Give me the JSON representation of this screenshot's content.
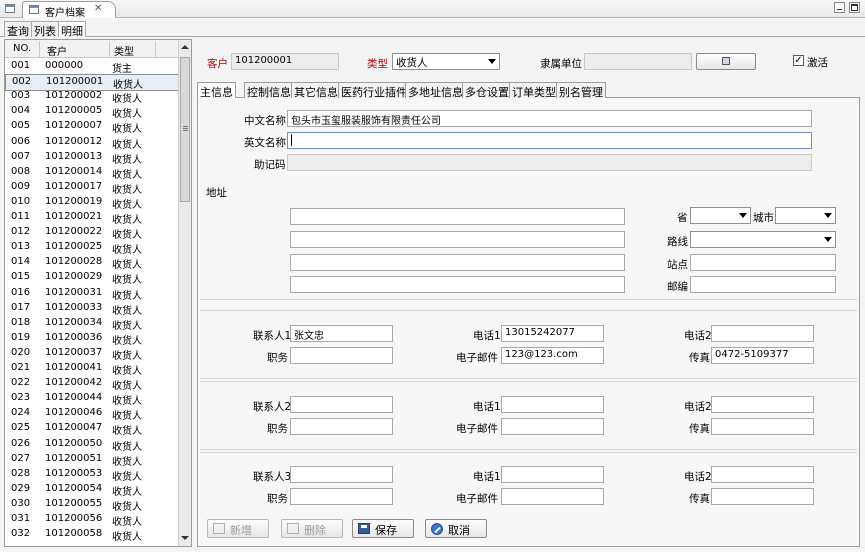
{
  "window": {
    "tab_title": "客户档案",
    "close_glyph": "✕"
  },
  "subtabs": [
    "查询",
    "列表",
    "明细"
  ],
  "list": {
    "headers": [
      "NO.",
      "客户",
      "类型"
    ],
    "rows": [
      [
        "001",
        "000000",
        "货主"
      ],
      [
        "002",
        "101200001",
        "收货人"
      ],
      [
        "003",
        "101200002",
        "收货人"
      ],
      [
        "004",
        "101200005",
        "收货人"
      ],
      [
        "005",
        "101200007",
        "收货人"
      ],
      [
        "006",
        "101200012",
        "收货人"
      ],
      [
        "007",
        "101200013",
        "收货人"
      ],
      [
        "008",
        "101200014",
        "收货人"
      ],
      [
        "009",
        "101200017",
        "收货人"
      ],
      [
        "010",
        "101200019",
        "收货人"
      ],
      [
        "011",
        "101200021",
        "收货人"
      ],
      [
        "012",
        "101200022",
        "收货人"
      ],
      [
        "013",
        "101200025",
        "收货人"
      ],
      [
        "014",
        "101200028",
        "收货人"
      ],
      [
        "015",
        "101200029",
        "收货人"
      ],
      [
        "016",
        "101200031",
        "收货人"
      ],
      [
        "017",
        "101200033",
        "收货人"
      ],
      [
        "018",
        "101200034",
        "收货人"
      ],
      [
        "019",
        "101200036",
        "收货人"
      ],
      [
        "020",
        "101200037",
        "收货人"
      ],
      [
        "021",
        "101200041",
        "收货人"
      ],
      [
        "022",
        "101200042",
        "收货人"
      ],
      [
        "023",
        "101200044",
        "收货人"
      ],
      [
        "024",
        "101200046",
        "收货人"
      ],
      [
        "025",
        "101200047",
        "收货人"
      ],
      [
        "026",
        "101200050",
        "收货人"
      ],
      [
        "027",
        "101200051",
        "收货人"
      ],
      [
        "028",
        "101200053",
        "收货人"
      ],
      [
        "029",
        "101200054",
        "收货人"
      ],
      [
        "030",
        "101200055",
        "收货人"
      ],
      [
        "031",
        "101200056",
        "收货人"
      ],
      [
        "032",
        "101200058",
        "收货人"
      ]
    ]
  },
  "header": {
    "customer_label": "客户",
    "customer_value": "101200001",
    "type_label": "类型",
    "type_value": "收货人",
    "parent_label": "隶属单位",
    "parent_value": "",
    "active_label": "激活",
    "active_checked": "✓"
  },
  "form_tabs": [
    "主信息",
    "控制信息",
    "其它信息",
    "医药行业插件",
    "多地址信息",
    "多仓设置",
    "订单类型",
    "别名管理"
  ],
  "main": {
    "cn_name_label": "中文名称",
    "cn_name_value": "包头市玉玺服装服饰有限责任公司",
    "en_name_label": "英文名称",
    "en_name_value": "",
    "mnemonic_label": "助记码",
    "mnemonic_value": "",
    "address_label": "地址",
    "province_label": "省",
    "city_label": "城市",
    "route_label": "路线",
    "station_label": "站点",
    "postcode_label": "邮编"
  },
  "contacts": [
    {
      "contact_label": "联系人1",
      "contact_value": "张文忠",
      "phone1_label": "电话1",
      "phone1_value": "13015242077",
      "phone2_label": "电话2",
      "phone2_value": "",
      "title_label": "职务",
      "title_value": "",
      "email_label": "电子邮件",
      "email_value": "123@123.com",
      "fax_label": "传真",
      "fax_value": "0472-5109377"
    },
    {
      "contact_label": "联系人2",
      "contact_value": "",
      "phone1_label": "电话1",
      "phone1_value": "",
      "phone2_label": "电话2",
      "phone2_value": "",
      "title_label": "职务",
      "title_value": "",
      "email_label": "电子邮件",
      "email_value": "",
      "fax_label": "传真",
      "fax_value": ""
    },
    {
      "contact_label": "联系人3",
      "contact_value": "",
      "phone1_label": "电话1",
      "phone1_value": "",
      "phone2_label": "电话2",
      "phone2_value": "",
      "title_label": "职务",
      "title_value": "",
      "email_label": "电子邮件",
      "email_value": "",
      "fax_label": "传真",
      "fax_value": ""
    }
  ],
  "buttons": {
    "new": "新增",
    "delete": "删除",
    "save": "保存",
    "cancel": "取消"
  },
  "colors": {
    "required_label": "#c00000",
    "selected_row": "#e8eef6"
  }
}
